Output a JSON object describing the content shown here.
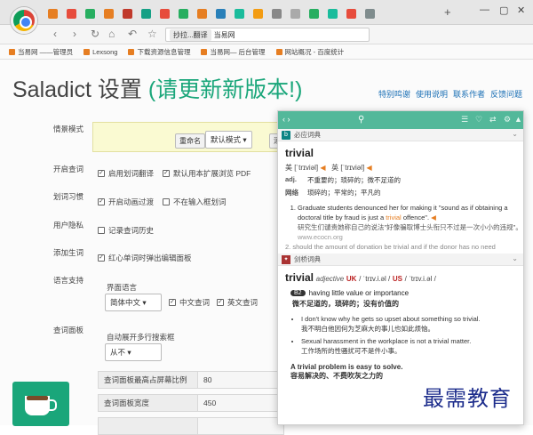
{
  "browser": {
    "address_tabs": [
      "抄拉...翻译",
      "当易网"
    ],
    "new_tab": "+",
    "win": [
      "—",
      "▢",
      "✕"
    ],
    "bookmarks": [
      "当易网 ——管理员",
      "Lexsong",
      "下载资源信息管理",
      "当易网— 后台管理",
      "网站概况 - 百度统计"
    ],
    "tab_colors": [
      "#e67e22",
      "#e74c3c",
      "#27ae60",
      "#e67e22",
      "#c0392b",
      "#16a085",
      "#e74c3c",
      "#27ae60",
      "#e67e22",
      "#2980b9",
      "#1abc9c",
      "#f39c12",
      "#888",
      "#aaa",
      "#27ae60",
      "#1abc9c",
      "#e74c3c",
      "#7f8c8d"
    ],
    "ext_colors": [
      "#333",
      "#e67e22",
      "#16a085",
      "#2980b9",
      "#f1c40f",
      "#c0392b",
      "#999"
    ]
  },
  "page": {
    "title": "Saladict 设置",
    "title_update": "(请更新新版本!)",
    "links": [
      "特别鸣谢",
      "使用说明",
      "联系作者",
      "反馈问题"
    ],
    "labels": {
      "mode": "情景模式",
      "enable": "开启查词",
      "habit": "划词习惯",
      "privacy": "用户隐私",
      "newword": "添加生词",
      "lang": "语言支持",
      "panel": "查词面板"
    },
    "mode_rename": "重命名",
    "mode_select": "默认模式",
    "mode_more": "添",
    "enable_items": [
      "启用划词翻译",
      "默认用本扩展浏览 PDF"
    ],
    "habit_items": [
      "开启动画过渡",
      "不在输入框划词"
    ],
    "privacy_item": "记录查词历史",
    "newword_item": "红心单词时弹出编辑面板",
    "ui_lang": "界面语言",
    "ui_lang_val": "简体中文",
    "lang_items": [
      "中文查词",
      "英文查词"
    ],
    "expand_label": "自动展开多行搜索框",
    "expand_val": "从不",
    "panel_rows": [
      {
        "k": "查词面板最高占屏幕比例",
        "v": "80"
      },
      {
        "k": "查词面板宽度",
        "v": "450"
      },
      {
        "k": "",
        "v": ""
      }
    ]
  },
  "popup": {
    "bing_title": "必应词典",
    "word": "trivial",
    "us": "美 [ˈtrɪviəl]",
    "uk": "英 [ˈtrɪviəl]",
    "defs": [
      {
        "pos": "adj.",
        "text": "不重要的；琐碎的；微不足道的"
      },
      {
        "pos": "网络",
        "text": "琐碎的；平常的；平凡的"
      }
    ],
    "example_en_1": "Graduate students denounced her for making it \"sound as if obtaining a doctoral title by fraud is just a ",
    "example_hl": "trivial",
    "example_en_2": " offence\".",
    "example_cn": "研究生们谴责她称自己的说法\"好像骗取博士头衔只不过是一次小小的违规\"。",
    "example_src": "www.ecocn.org",
    "faded": "should the amount of donation be trivial and if the donor has no need",
    "cam_title": "剑桥词典",
    "cam_pos": "adjective",
    "cam_uk": "UK",
    "cam_uk_ipa": "/ ˈtrɪv.i.əl /",
    "cam_us": "US",
    "cam_us_ipa": "/ ˈtrɪv.i.əl /",
    "level": "B2",
    "level_en": "having little value or importance",
    "level_cn": "微不足道的，琐碎的；没有价值的",
    "ex1_en": "I don't know why he gets so upset about something so trivial.",
    "ex1_cn": "我不明白他因何为芝麻大的事儿也如此烦恼。",
    "ex2_en": "Sexual harassment in the workplace is not a trivial matter.",
    "ex2_cn": "工作场所的性骚扰可不是件小事。",
    "ex3_en": "A trivial problem is easy to solve.",
    "ex3_cn": "容易解决的、不费吹灰之力的"
  },
  "watermark": "最需教育"
}
